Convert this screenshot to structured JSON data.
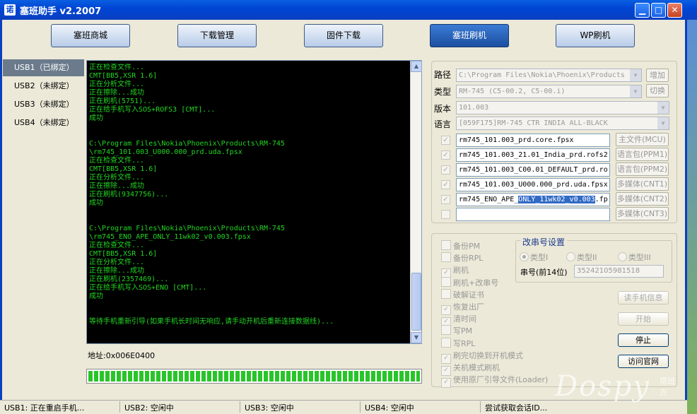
{
  "window": {
    "icon_glyph": "诺",
    "title": "塞班助手  v2.2007"
  },
  "nav": [
    "塞班商城",
    "下载管理",
    "固件下载",
    "塞班刷机",
    "WP刷机"
  ],
  "usb_list": [
    "USB1（已绑定）",
    "USB2（未绑定）",
    "USB3（未绑定）",
    "USB4（未绑定）"
  ],
  "console_lines": [
    "正在检查文件...",
    "CMT[BB5,XSR 1.6]",
    "正在分析文件...",
    "正在擦除...成功",
    "正在刷机(5751)...",
    "正在给手机写入SOS+ROFS3 [CMT]...",
    "成功",
    "",
    "",
    "C:\\Program Files\\Nokia\\Phoenix\\Products\\RM-745",
    "\\rm745_101.003_U000.000_prd.uda.fpsx",
    "正在检查文件...",
    "CMT[BB5,XSR 1.6]",
    "正在分析文件...",
    "正在擦除...成功",
    "正在刷机(9347756)...",
    "成功",
    "",
    "",
    "C:\\Program Files\\Nokia\\Phoenix\\Products\\RM-745",
    "\\rm745_ENO_APE_ONLY_11wk02_v0.003.fpsx",
    "正在检查文件...",
    "CMT[BB5,XSR 1.6]",
    "正在分析文件...",
    "正在擦除...成功",
    "正在刷机(2357469)...",
    "正在给手机写入SOS+ENO [CMT]...",
    "成功",
    "",
    "",
    "等待手机重新引导(如果手机长时间无响应,请手动开机后重新连接数据线)..."
  ],
  "address": "地址:0x006E0400",
  "progress_percent": 100,
  "settings": {
    "path_label": "路径",
    "path_value": "C:\\Program Files\\Nokia\\Phoenix\\Products",
    "add_btn": "增加",
    "type_label": "类型",
    "type_value": "RM-745  (C5-00.2, C5-00.i)",
    "switch_btn": "切换",
    "version_label": "版本",
    "version_value": "101.003",
    "lang_label": "语言",
    "lang_value": "[059F175]RM-745 CTR INDIA ALL-BLACK"
  },
  "files": [
    {
      "name": "rm745_101.003_prd.core.fpsx",
      "btn": "主文件(MCU)",
      "checked": true
    },
    {
      "name": "rm745_101.003_21.01_India_prd.rofs2.",
      "btn": "语言包(PPM1)",
      "checked": true
    },
    {
      "name": "rm745_101.003_C00.01_DEFAULT_prd.ro:",
      "btn": "语言包(PPM2)",
      "checked": true
    },
    {
      "name": "rm745_101.003_U000.000_prd.uda.fpsx",
      "btn": "多媒体(CNT1)",
      "checked": true
    },
    {
      "name_pre": "rm745_ENO_APE_",
      "name_sel": "ONLY_11wk02_v0.003",
      "name_post": ".fp:",
      "btn": "多媒体(CNT2)",
      "checked": true
    },
    {
      "name": "",
      "btn": "多媒体(CNT3)",
      "checked": false
    }
  ],
  "options": [
    {
      "label": "备份PM",
      "checked": false
    },
    {
      "label": "备份RPL",
      "checked": false
    },
    {
      "label": "刷机",
      "checked": true
    },
    {
      "label": "刷机+改串号",
      "checked": false
    },
    {
      "label": "破解证书",
      "checked": false
    },
    {
      "label": "恢复出厂",
      "checked": true
    },
    {
      "label": "清时间",
      "checked": true
    },
    {
      "label": "写PM",
      "checked": false
    },
    {
      "label": "写RPL",
      "checked": false
    },
    {
      "label": "刷完切换到开机模式",
      "checked": true
    },
    {
      "label": "关机模式刷机",
      "checked": true
    },
    {
      "label": "使用原厂引导文件(Loader)",
      "checked": true
    }
  ],
  "serial": {
    "title": "改串号设置",
    "radios": [
      "类型I",
      "类型II",
      "类型III"
    ],
    "label": "串号(前14位)",
    "value": "35242105981518"
  },
  "actions": {
    "read_info": "读手机信息",
    "start": "开始",
    "stop": "停止",
    "visit": "访问官网"
  },
  "status": [
    "USB1: 正在重启手机...",
    "USB2: 空闲中",
    "USB3: 空闲中",
    "USB4: 空闲中",
    "尝试获取会话ID..."
  ],
  "watermark": {
    "text": "Dospy",
    "sub": "塔班方"
  }
}
